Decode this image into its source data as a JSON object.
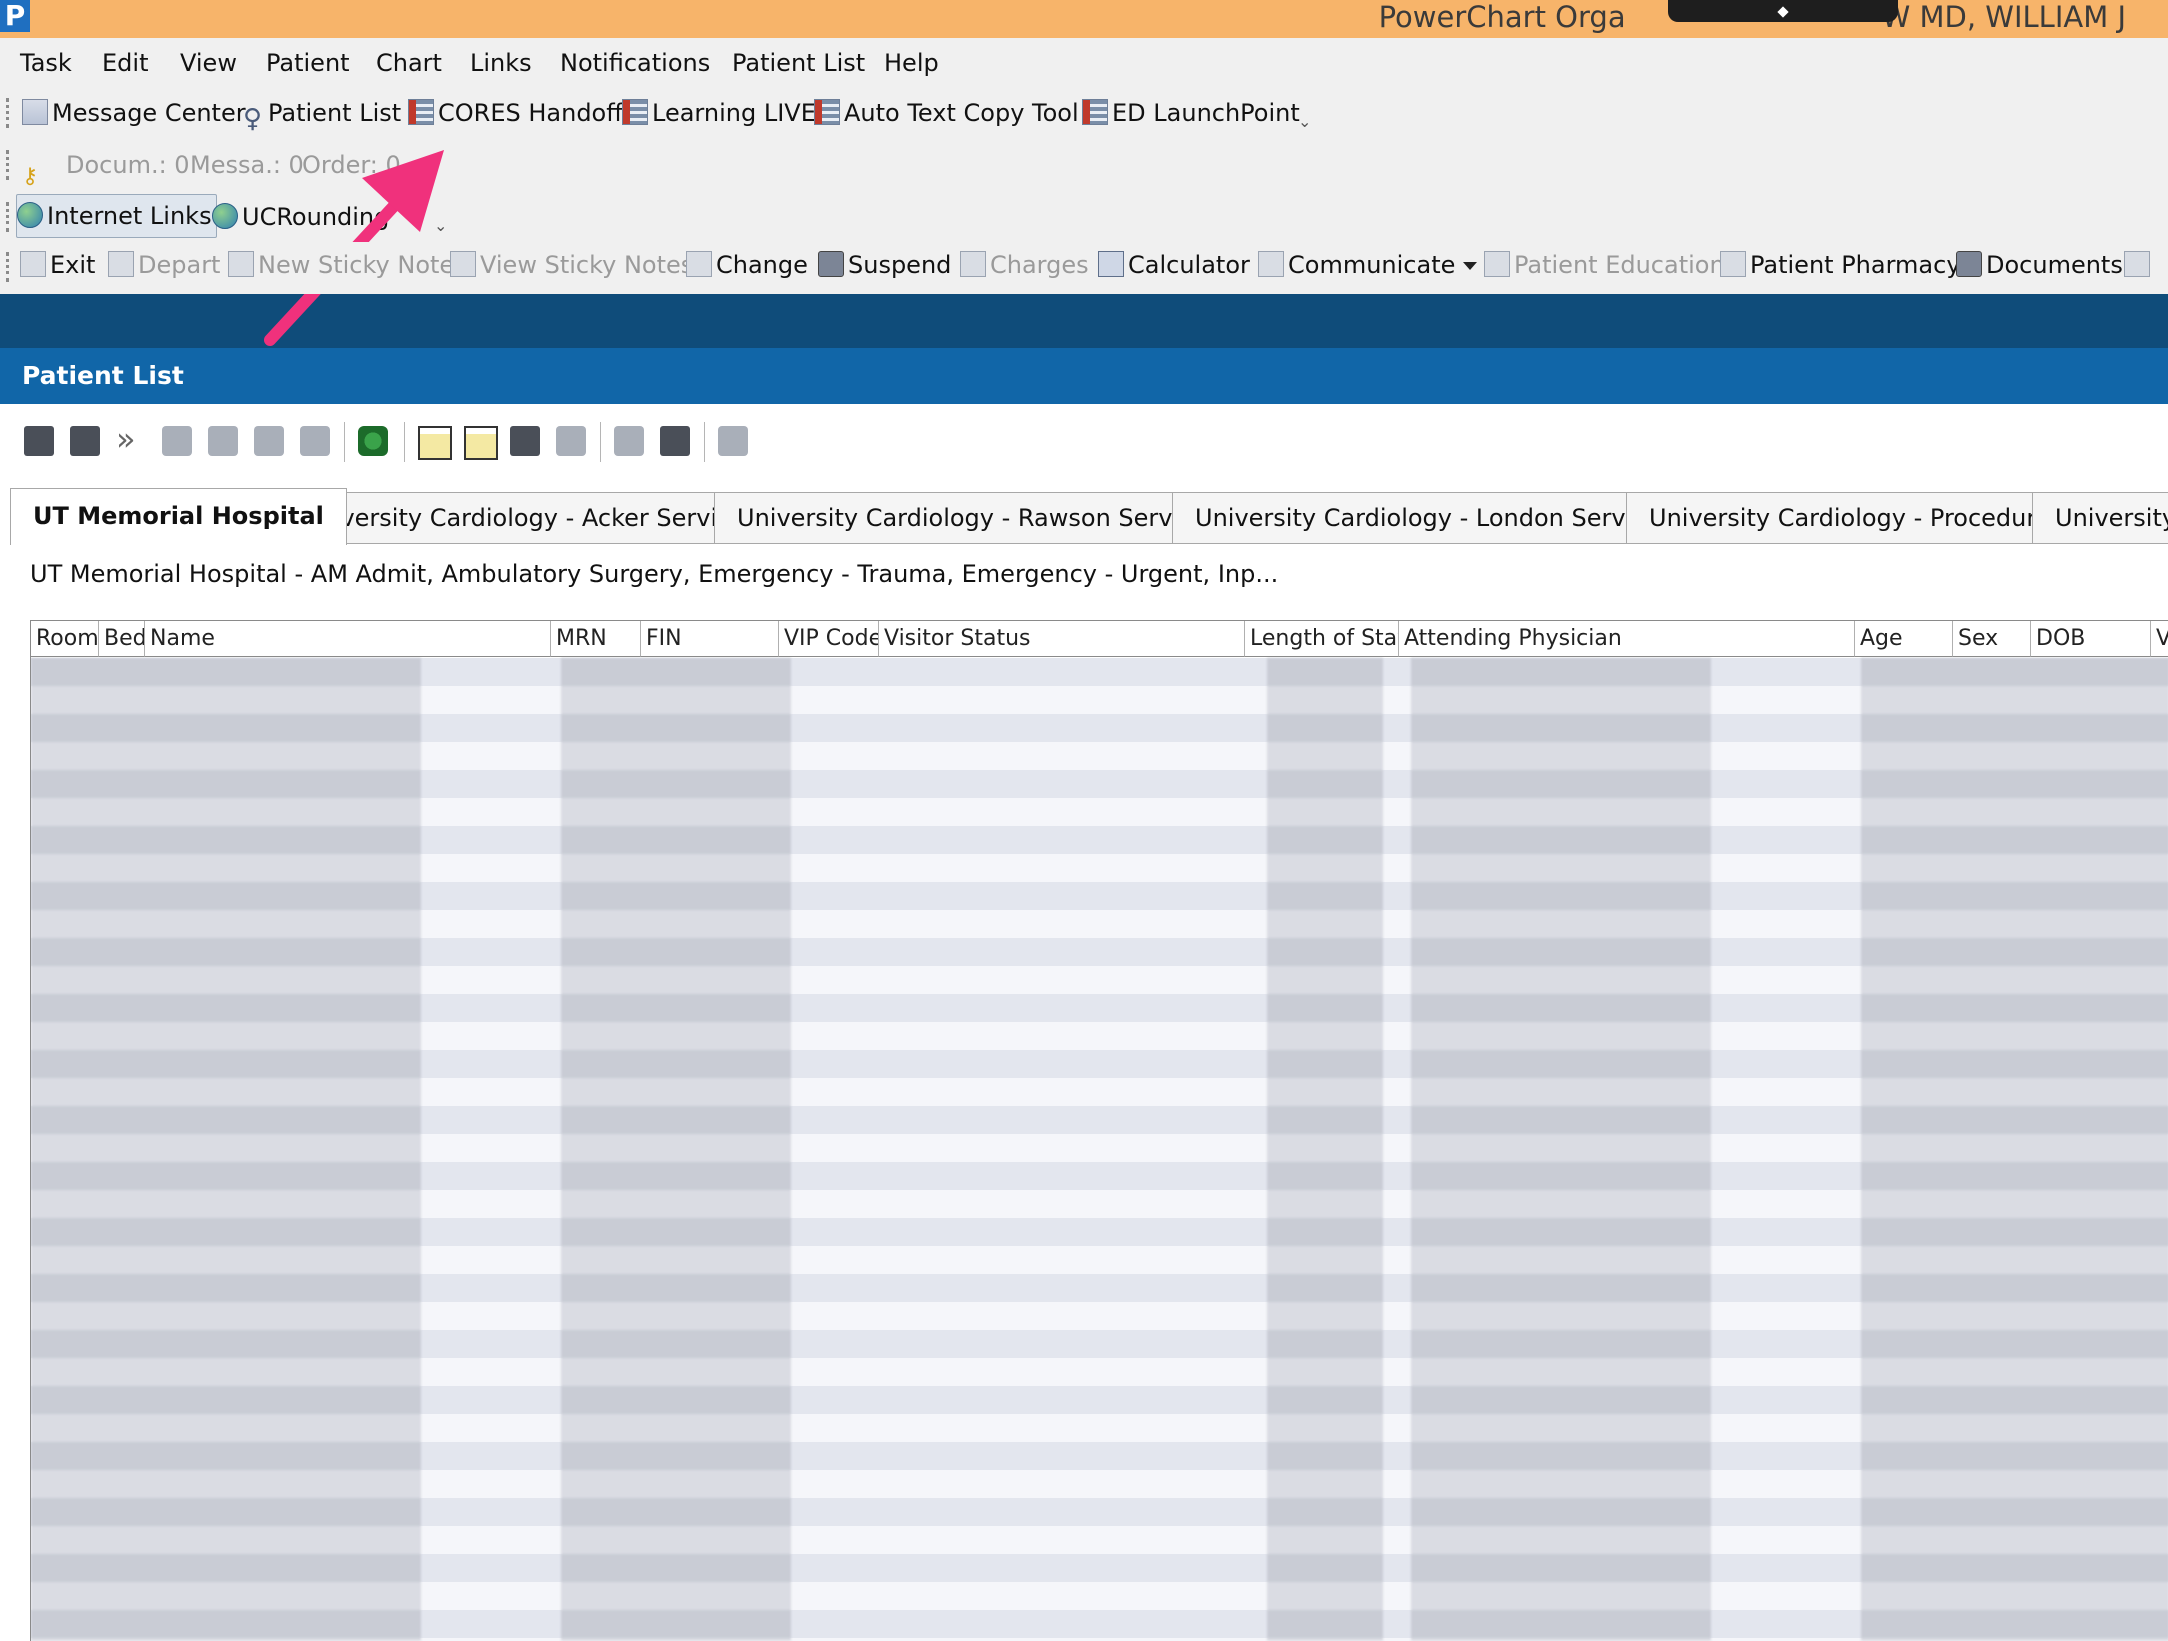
{
  "window": {
    "title": "PowerChart Organizer for PRABHW MD, WILLIAM J",
    "title_visible": "PowerChart Orga",
    "title_suffix": "W MD, WILLIAM J",
    "app_icon": "P"
  },
  "menu": [
    "Task",
    "Edit",
    "View",
    "Patient",
    "Chart",
    "Links",
    "Notifications",
    "Patient List",
    "Help"
  ],
  "toolbar1": [
    {
      "label": "Message Center",
      "icon": "message-icon"
    },
    {
      "label": "Patient List",
      "icon": "person-icon"
    },
    {
      "label": "CORES Handoff",
      "icon": "grid-icon"
    },
    {
      "label": "Learning LIVE",
      "icon": "grid-icon"
    },
    {
      "label": "Auto Text Copy Tool",
      "icon": "grid-icon"
    },
    {
      "label": "ED LaunchPoint",
      "icon": "grid-icon"
    }
  ],
  "toolbar2": [
    {
      "label": "Docum.: 0"
    },
    {
      "label": "Messa.: 0"
    },
    {
      "label": "Order: 0"
    }
  ],
  "toolbar3": [
    {
      "label": "Internet Links",
      "icon": "globe-icon"
    },
    {
      "label": "UCRounding",
      "icon": "globe-icon"
    }
  ],
  "toolbar4": [
    {
      "label": "Exit",
      "enabled": true
    },
    {
      "label": "Depart",
      "enabled": false
    },
    {
      "label": "New Sticky Note",
      "enabled": false
    },
    {
      "label": "View Sticky Notes",
      "enabled": false
    },
    {
      "label": "Change",
      "enabled": true
    },
    {
      "label": "Suspend",
      "enabled": true
    },
    {
      "label": "Charges",
      "enabled": false
    },
    {
      "label": "Calculator",
      "enabled": true
    },
    {
      "label": "Communicate",
      "enabled": true
    },
    {
      "label": "Patient Education",
      "enabled": false
    },
    {
      "label": "Patient Pharmacy",
      "enabled": true
    },
    {
      "label": "Documents",
      "enabled": true
    }
  ],
  "section_title": "Patient List",
  "tabs": [
    {
      "label": "UT Memorial Hospital",
      "active": true
    },
    {
      "label": "University Cardiology - Acker Service"
    },
    {
      "label": "University Cardiology - Rawson Service"
    },
    {
      "label": "University Cardiology - London Service"
    },
    {
      "label": "University Cardiology - Procedures"
    },
    {
      "label": "University C"
    }
  ],
  "list_caption": "UT Memorial Hospital - AM Admit, Ambulatory Surgery, Emergency - Trauma, Emergency - Urgent, Inp...",
  "columns": [
    "Room",
    "Bed",
    "Name",
    "MRN",
    "FIN",
    "VIP Code",
    "Visitor Status",
    "Length of Stay",
    "Attending Physician",
    "Age",
    "Sex",
    "DOB",
    "V"
  ],
  "annotation": {
    "type": "arrow",
    "color": "#f0317c",
    "points_to": "CORES Handoff"
  }
}
